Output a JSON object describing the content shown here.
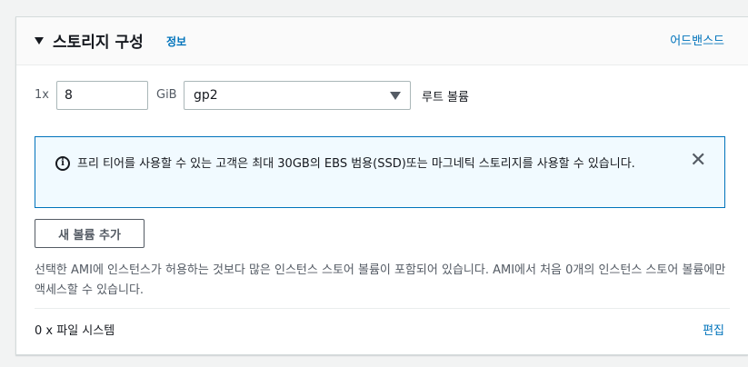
{
  "header": {
    "title": "스토리지 구성",
    "info_label": "정보",
    "advanced_label": "어드밴스드"
  },
  "volume": {
    "multiplier": "1x",
    "size_value": "8",
    "size_unit": "GiB",
    "type_value": "gp2",
    "label": "루트 볼륨"
  },
  "alert": {
    "icon": "info-icon",
    "text": "프리 티어를 사용할 수 있는 고객은 최대 30GB의 EBS 범용(SSD)또는 마그네틱 스토리지를 사용할 수 있습니다.",
    "close_glyph": "✕"
  },
  "actions": {
    "add_volume_label": "새 볼륨 추가"
  },
  "description": "선택한 AMI에 인스턴스가 허용하는 것보다 많은 인스턴스 스토어 볼륨이 포함되어 있습니다. AMI에서 처음 0개의 인스턴스 스토어 볼륨에만 액세스할 수 있습니다.",
  "file_systems": {
    "label": "0 x 파일 시스템",
    "edit_label": "편집"
  },
  "colors": {
    "link": "#0073bb",
    "alert_bg": "#f1faff",
    "alert_border": "#0073bb"
  }
}
